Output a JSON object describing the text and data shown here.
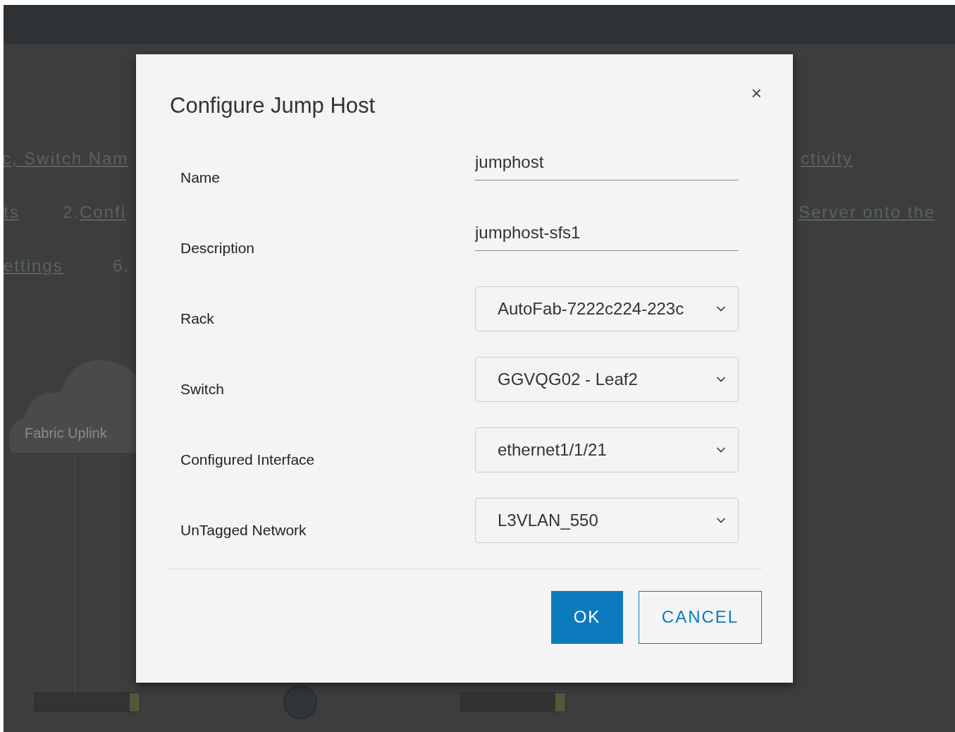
{
  "background": {
    "links_row_1": [
      "c, Switch Nam",
      "ctivity"
    ],
    "links_row_2": [
      {
        "text": "ts"
      },
      {
        "number": "2.",
        "text": "Confi"
      },
      {
        "text": "Server onto the"
      }
    ],
    "links_row_3": [
      {
        "text": "ettings"
      },
      {
        "number": "6."
      }
    ],
    "cloud_label": "Fabric Uplink"
  },
  "dialog": {
    "title": "Configure Jump Host",
    "close": "×",
    "fields": [
      {
        "kind": "text",
        "label": "Name",
        "value": "jumphost"
      },
      {
        "kind": "text",
        "label": "Description",
        "value": "jumphost-sfs1"
      },
      {
        "kind": "select",
        "label": "Rack",
        "value": "AutoFab-7222c224-223c"
      },
      {
        "kind": "select",
        "label": "Switch",
        "value": "GGVQG02 - Leaf2"
      },
      {
        "kind": "select",
        "label": "Configured Interface",
        "value": "ethernet1/1/21"
      },
      {
        "kind": "select",
        "label": "UnTagged Network",
        "value": "L3VLAN_550"
      }
    ],
    "buttons": [
      {
        "kind": "primary",
        "label": "OK"
      },
      {
        "kind": "secondary",
        "label": "CANCEL"
      }
    ]
  }
}
